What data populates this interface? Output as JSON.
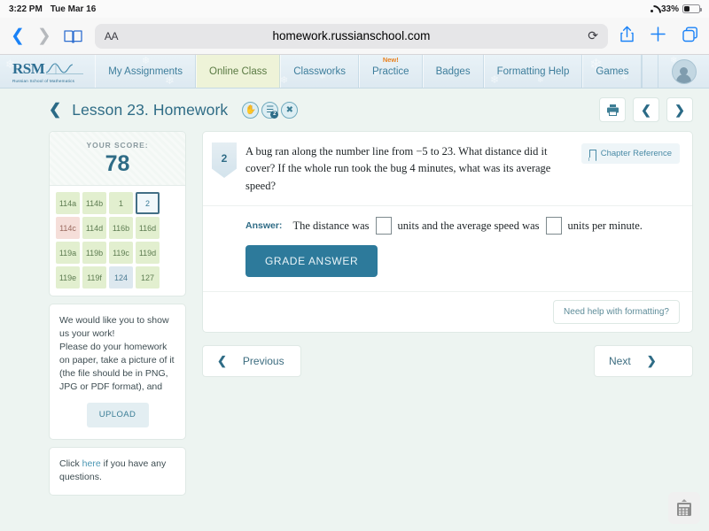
{
  "status_bar": {
    "time": "3:22 PM",
    "date": "Tue Mar 16",
    "battery_percent": "33%",
    "wifi_icon": "wifi-icon",
    "battery_icon": "battery-icon"
  },
  "browser": {
    "back_icon": "back-chevron-icon",
    "forward_icon": "forward-chevron-icon",
    "bookmarks_icon": "book-icon",
    "text_size_label": "AA",
    "url": "homework.russianschool.com",
    "reload_icon": "reload-icon",
    "share_icon": "share-icon",
    "new_tab_icon": "plus-icon",
    "tabs_icon": "tabs-icon"
  },
  "site_nav": {
    "logo_text": "RSM",
    "logo_subtitle": "Russian School of Mathematics",
    "tabs": [
      {
        "label": "My Assignments",
        "active": false,
        "badge": ""
      },
      {
        "label": "Online Class",
        "active": true,
        "badge": ""
      },
      {
        "label": "Classworks",
        "active": false,
        "badge": ""
      },
      {
        "label": "Practice",
        "active": false,
        "badge": "New!"
      },
      {
        "label": "Badges",
        "active": false,
        "badge": ""
      },
      {
        "label": "Formatting Help",
        "active": false,
        "badge": ""
      },
      {
        "label": "Games",
        "active": false,
        "badge": ""
      }
    ],
    "avatar_name": "avatar"
  },
  "lesson_header": {
    "back_icon": "back-chevron-icon",
    "title": "Lesson 23. Homework",
    "icons": [
      {
        "name": "hand-icon",
        "glyph": "✋",
        "badge": ""
      },
      {
        "name": "layers-icon",
        "glyph": "≡",
        "badge": "2"
      },
      {
        "name": "tools-icon",
        "glyph": "✖",
        "badge": ""
      }
    ],
    "print_icon": "printer-icon",
    "prev_icon": "prev-chevron-icon",
    "next_icon": "next-chevron-icon"
  },
  "score_panel": {
    "label": "YOUR SCORE:",
    "value": "78",
    "problems": [
      {
        "label": "114a",
        "state": "done"
      },
      {
        "label": "114b",
        "state": "done"
      },
      {
        "label": "1",
        "state": "done"
      },
      {
        "label": "2",
        "state": "current"
      },
      {
        "label": "114c",
        "state": "wrong"
      },
      {
        "label": "114d",
        "state": "done"
      },
      {
        "label": "116b",
        "state": "done"
      },
      {
        "label": "116d",
        "state": "done"
      },
      {
        "label": "119a",
        "state": "done"
      },
      {
        "label": "119b",
        "state": "done"
      },
      {
        "label": "119c",
        "state": "done"
      },
      {
        "label": "119d",
        "state": "done"
      },
      {
        "label": "119e",
        "state": "done"
      },
      {
        "label": "119f",
        "state": "done"
      },
      {
        "label": "124",
        "state": "skipped"
      },
      {
        "label": "127",
        "state": "done"
      }
    ]
  },
  "work_panel": {
    "line1": "We would like you to show us your work!",
    "line2": "Please do your homework on paper, take a picture of it (the file should be in PNG, JPG or PDF format), and",
    "upload_label": "UPLOAD"
  },
  "questions_panel": {
    "prefix": "Click ",
    "link": "here",
    "suffix": " if you have any questions."
  },
  "question": {
    "number": "2",
    "text": "A bug ran along the number line from −5 to 23. What distance did it cover? If the whole run took the bug 4 minutes, what was its average speed?",
    "chapter_reference_label": "Chapter Reference",
    "chapter_reference_icon": "bookmark-icon",
    "answer_label": "Answer:",
    "answer_part1": "The distance was",
    "answer_blank1_value": "",
    "answer_part2": "units and the average speed was",
    "answer_blank2_value": "",
    "answer_part3": "units per minute.",
    "grade_button_label": "GRADE ANSWER",
    "help_button_label": "Need help with formatting?"
  },
  "pager": {
    "previous_label": "Previous",
    "previous_icon": "left-chevron-icon",
    "next_label": "Next",
    "next_icon": "right-chevron-icon"
  },
  "floating": {
    "calculator_icon": "calculator-icon"
  },
  "colors": {
    "accent_teal": "#2d7a9b",
    "page_bg": "#edf4f1",
    "active_tab": "#eef3d8",
    "done_cell": "#e2efcf",
    "wrong_cell": "#f5ded9",
    "skipped_cell": "#dde8ef",
    "new_badge": "#e8811f"
  }
}
